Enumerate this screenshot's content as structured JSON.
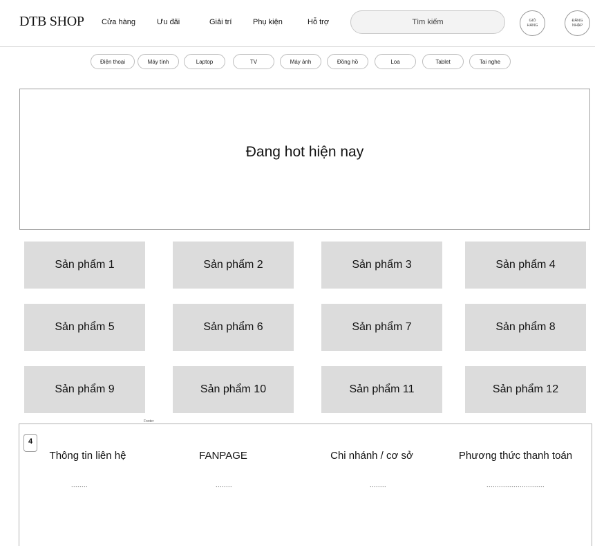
{
  "header": {
    "logo": "DTB SHOP",
    "nav": [
      "Cửa hàng",
      "Ưu đãi",
      "Giải trí",
      "Phụ kiện",
      "Hỗ trợ"
    ],
    "search_placeholder": "Tìm kiếm",
    "cart_label": "GIỎ HÀNG",
    "login_label": "ĐĂNG NHẬP"
  },
  "categories": [
    "Điện thoại",
    "Máy tính",
    "Laptop",
    "TV",
    "Máy ảnh",
    "Đồng hồ",
    "Loa",
    "Tablet",
    "Tai nghe"
  ],
  "hero": {
    "title": "Đang hot hiện nay"
  },
  "products": [
    "Sản phẩm 1",
    "Sản phẩm 2",
    "Sản phẩm 3",
    "Sản phẩm 4",
    "Sản phẩm 5",
    "Sản phẩm 6",
    "Sản phẩm 7",
    "Sản phẩm 8",
    "Sản phẩm 9",
    "Sản phẩm 10",
    "Sản phẩm 11",
    "Sản phẩm 12"
  ],
  "footer": {
    "label": "Footer",
    "badge": "4",
    "columns": [
      {
        "heading": "Thông tin liên hệ",
        "value": "........"
      },
      {
        "heading": "FANPAGE",
        "value": "........"
      },
      {
        "heading": "Chi nhánh / cơ sở",
        "value": "........"
      },
      {
        "heading": "Phương thức thanh toán",
        "value": "............................"
      }
    ]
  }
}
